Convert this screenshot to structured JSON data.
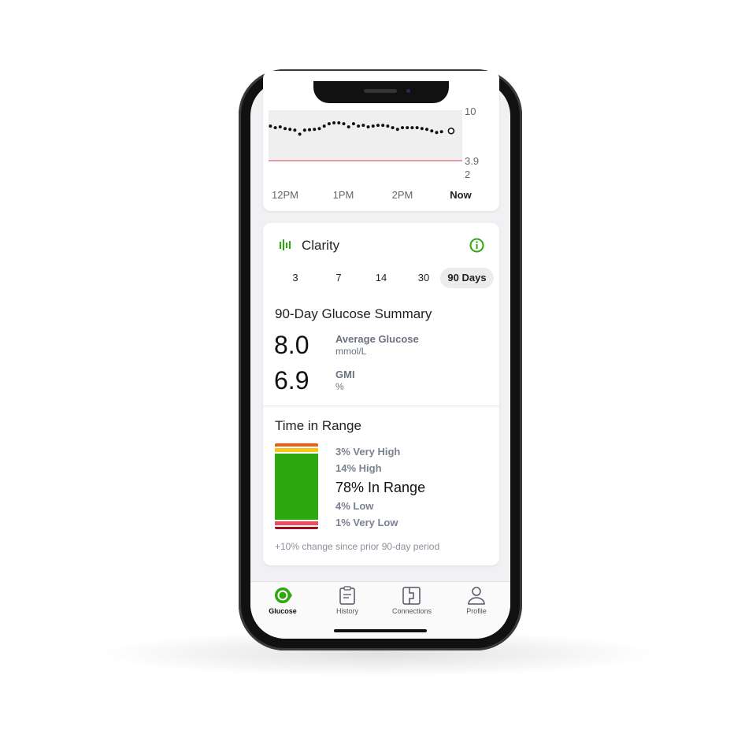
{
  "chart_data": {
    "type": "scatter",
    "y_ticks": [
      "10",
      "3.9",
      "2"
    ],
    "x_ticks": [
      "12PM",
      "1PM",
      "2PM",
      "Now"
    ],
    "ylim": [
      2,
      10
    ],
    "low_threshold": 3.9,
    "target_band": [
      3.9,
      10
    ],
    "times": [
      "11:45",
      "11:50",
      "11:55",
      "12:00",
      "12:05",
      "12:10",
      "12:15",
      "12:20",
      "12:25",
      "12:30",
      "12:35",
      "12:40",
      "12:45",
      "12:50",
      "12:55",
      "13:00",
      "13:05",
      "13:10",
      "13:15",
      "13:20",
      "13:25",
      "13:30",
      "13:35",
      "13:40",
      "13:45",
      "13:50",
      "13:55",
      "14:00",
      "14:05",
      "14:10",
      "14:15",
      "14:20",
      "14:25",
      "14:30",
      "14:35",
      "14:40",
      "14:45"
    ],
    "values": [
      8.2,
      8.0,
      8.1,
      7.9,
      7.8,
      7.7,
      7.2,
      7.7,
      7.75,
      7.8,
      7.9,
      8.2,
      8.5,
      8.6,
      8.6,
      8.5,
      8.1,
      8.5,
      8.2,
      8.3,
      8.1,
      8.2,
      8.3,
      8.3,
      8.2,
      8.0,
      7.8,
      8.0,
      8.0,
      8.0,
      8.0,
      7.9,
      7.8,
      7.6,
      7.4,
      7.5,
      7.6
    ],
    "colors": {
      "band": "#efeff0",
      "low_line": "#e8808a",
      "dot": "#111111"
    }
  },
  "clarity": {
    "title": "Clarity",
    "icon": "bar-chart-icon",
    "info_icon": "info-icon",
    "tabs": [
      "3",
      "7",
      "14",
      "30",
      "90 Days"
    ],
    "selected_tab": "90 Days"
  },
  "summary": {
    "title": "90-Day Glucose Summary",
    "avg_value": "8.0",
    "avg_label": "Average Glucose",
    "avg_unit": "mmol/L",
    "gmi_value": "6.9",
    "gmi_label": "GMI",
    "gmi_unit": "%"
  },
  "tir": {
    "title": "Time in Range",
    "very_high": "3% Very High",
    "high": "14% High",
    "in_range": "78% In Range",
    "low": "4% Low",
    "very_low": "1% Very Low",
    "change": "+10% change since prior 90-day period",
    "colors": {
      "very_high": "#f05a1e",
      "high": "#f5c518",
      "in_range": "#2ea80f",
      "low": "#e8505a",
      "very_low": "#9b1020"
    }
  },
  "nav": {
    "items": [
      {
        "label": "Glucose",
        "icon": "glucose-icon"
      },
      {
        "label": "History",
        "icon": "clipboard-icon"
      },
      {
        "label": "Connections",
        "icon": "connections-icon"
      },
      {
        "label": "Profile",
        "icon": "person-icon"
      }
    ],
    "active": "Glucose",
    "accent": "#2ea80f"
  }
}
